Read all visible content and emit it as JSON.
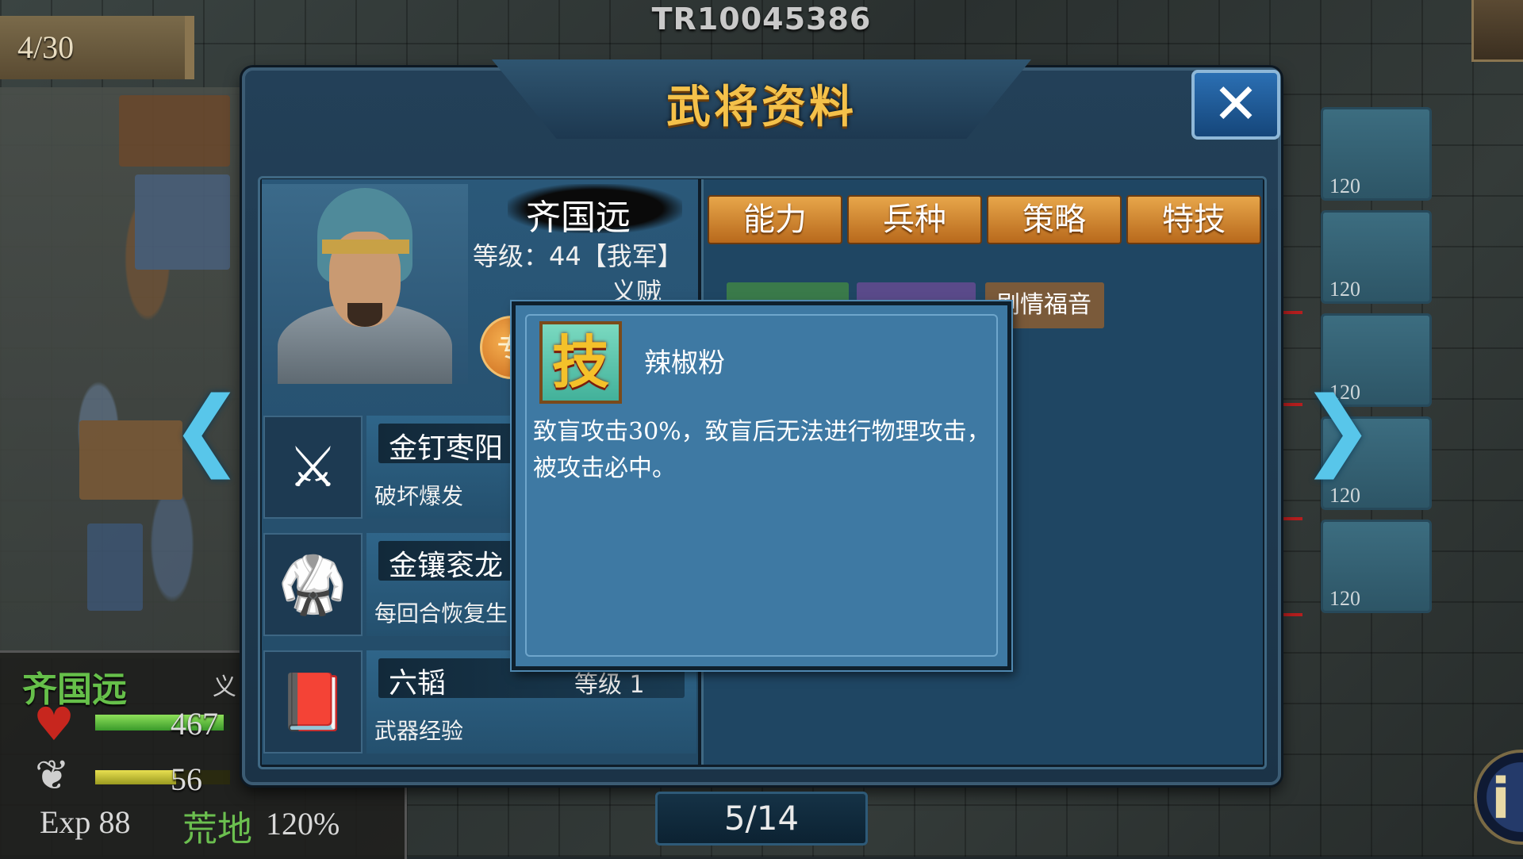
{
  "top_id": "TR10045386",
  "turn_counter": "4/30",
  "dialog": {
    "title": "武将资料",
    "close_label": "✕"
  },
  "general": {
    "name": "齐国远",
    "level_text": "等级：44【我军】",
    "class_text": "义贼",
    "orb_label": "专"
  },
  "equipment": [
    {
      "name": "金钉枣阳",
      "level": "",
      "desc": "破坏爆发",
      "icon": "spear-icon",
      "glyph": "⚔"
    },
    {
      "name": "金镶衮龙",
      "level": "",
      "desc": "每回合恢复生",
      "icon": "robe-icon",
      "glyph": "🥋"
    },
    {
      "name": "六韬",
      "level": "等级 1",
      "desc": "武器经验",
      "icon": "book-icon",
      "glyph": "📕"
    }
  ],
  "tabs": [
    "能力",
    "兵种",
    "策略",
    "特技"
  ],
  "chips": [
    {
      "label": "",
      "color": "#3a7a4a"
    },
    {
      "label": "",
      "color": "#5a4a8a"
    },
    {
      "label": "剧情福音",
      "color": "#7a5a3a"
    }
  ],
  "page_indicator": "5/14",
  "popup": {
    "icon_char": "技",
    "skill_name": "辣椒粉",
    "desc": "致盲攻击30%，致盲后无法进行物理攻击，被攻击必中。"
  },
  "status": {
    "name": "齐国远",
    "tag": "义",
    "hp": "467",
    "mp": "56",
    "exp_label": "Exp",
    "exp_value": "88",
    "terrain": "荒地",
    "terrain_pct": "120%",
    "hp_fraction": 0.95,
    "mp_fraction": 0.6
  },
  "map_slots": [
    "120",
    "120",
    "120",
    "120",
    "120"
  ],
  "colors": {
    "accent_gold": "#f4c14a",
    "hp_green": "#66c04a",
    "panel_blue": "#3e79a3",
    "arrow_cyan": "#58c6ea"
  }
}
